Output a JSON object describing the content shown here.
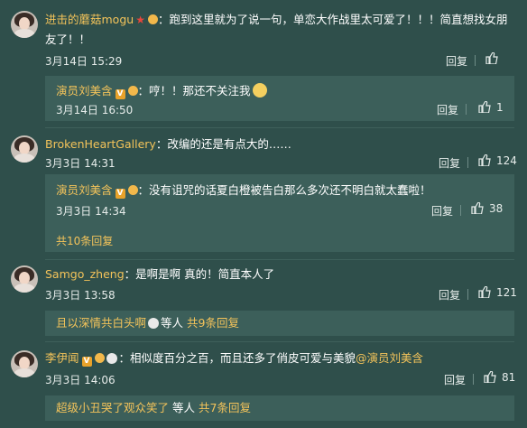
{
  "comments": [
    {
      "user": "进击的蘑菇mogu",
      "text_line1": "：跑到这里就为了说一句，单恋大作战里太可爱了！！！简直想找女朋",
      "text_line2": "友了！！",
      "time": "3月14日 15:29",
      "reply_label": "回复",
      "likes": "",
      "reply": {
        "user": "演员刘美含",
        "text": "：哼！！那还不关注我",
        "time": "3月14日 16:50",
        "reply_label": "回复",
        "likes": "1"
      }
    },
    {
      "user": "BrokenHeartGallery",
      "text": "：改编的还是有点大的……",
      "time": "3月3日 14:31",
      "reply_label": "回复",
      "likes": "124",
      "reply": {
        "user": "演员刘美含",
        "text": "：没有诅咒的话夏白橙被告白那么多次还不明白就太蠢啦！",
        "time": "3月3日 14:34",
        "reply_label": "回复",
        "likes": "38"
      },
      "more": "共10条回复"
    },
    {
      "user": "Samgo_zheng",
      "text": "：是啊是啊 真的！简直本人了",
      "time": "3月3日 13:58",
      "reply_label": "回复",
      "likes": "121",
      "sub_preview": {
        "user": "且以深情共白头啊",
        "suffix": "等人",
        "count": "共9条回复"
      }
    },
    {
      "user": "李伊闻",
      "text": "：相似度百分之百，而且还多了俏皮可爱与美貌",
      "mention": "@演员刘美含",
      "time": "3月3日 14:06",
      "reply_label": "回复",
      "likes": "81",
      "sub_preview": {
        "user": "超级小丑哭了观众笑了",
        "suffix": "等人",
        "count": "共7条回复"
      }
    }
  ]
}
